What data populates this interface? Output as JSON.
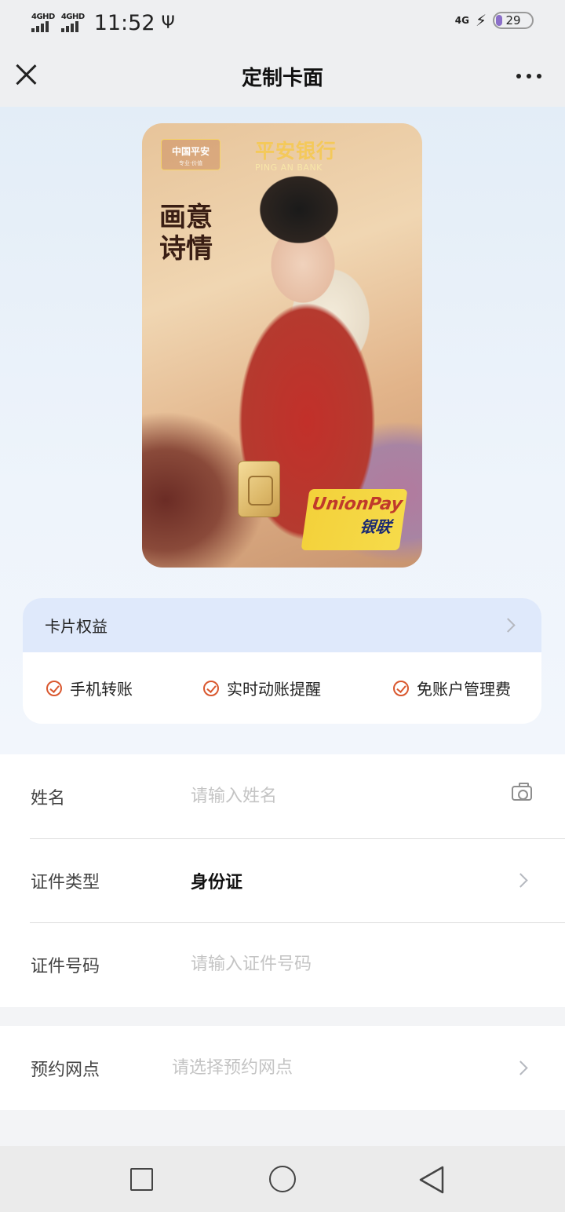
{
  "status_bar": {
    "signal_1": "4GHD",
    "signal_2": "4GHD",
    "time": "11:52",
    "usb_icon": "usb-icon",
    "network": "4G",
    "charging_icon": "bolt-icon",
    "battery": "29"
  },
  "nav": {
    "close_icon": "close-icon",
    "title": "定制卡面",
    "more_icon": "more-icon"
  },
  "card": {
    "logo_text": "中国平安",
    "logo_sub": "专业·价值",
    "bank_name_cn": "平安银行",
    "bank_name_en": "PING AN BANK",
    "calligraphy": "画意诗情",
    "network_en": "UnionPay",
    "network_cn": "银联"
  },
  "benefits": {
    "header": "卡片权益",
    "items": [
      "手机转账",
      "实时动账提醒",
      "免账户管理费"
    ]
  },
  "form": {
    "name_label": "姓名",
    "name_placeholder": "请输入姓名",
    "id_type_label": "证件类型",
    "id_type_value": "身份证",
    "id_number_label": "证件号码",
    "id_number_placeholder": "请输入证件号码",
    "branch_label": "预约网点",
    "branch_placeholder": "请选择预约网点"
  },
  "colors": {
    "accent": "#d9582f",
    "benefit_header_bg": "#dfe9fb",
    "bank_gold": "#f4c95a"
  }
}
